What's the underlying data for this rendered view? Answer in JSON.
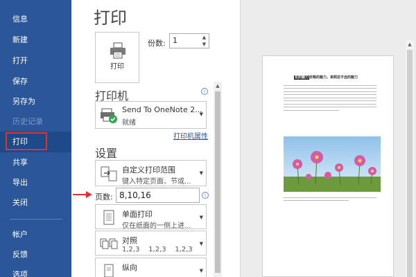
{
  "sidebar": {
    "items": [
      {
        "label": "信息"
      },
      {
        "label": "新建"
      },
      {
        "label": "打开"
      },
      {
        "label": "保存"
      },
      {
        "label": "另存为"
      },
      {
        "label": "历史记录"
      },
      {
        "label": "打印"
      },
      {
        "label": "共享"
      },
      {
        "label": "导出"
      },
      {
        "label": "关闭"
      },
      {
        "label": "帐户"
      },
      {
        "label": "反馈"
      },
      {
        "label": "选项"
      }
    ],
    "active_item": "打印",
    "disabled_item": "历史记录"
  },
  "page_title": "打印",
  "print_button": {
    "label": "打印",
    "icon": "printer-icon"
  },
  "copies": {
    "label": "份数:",
    "value": "1"
  },
  "printer": {
    "section_title": "打印机",
    "name": "Send To OneNote 2...",
    "status": "就绪",
    "properties_link": "打印机属性"
  },
  "settings": {
    "section_title": "设置",
    "range": {
      "line1": "自定义打印范围",
      "line2": "键入特定页面、节或..."
    },
    "pages": {
      "label": "页数:",
      "value": "8,10,16"
    },
    "sides": {
      "line1": "单面打印",
      "line2": "仅在纸面的一侧上进..."
    },
    "collate": {
      "line1": "对照",
      "line2a": "1,2,3",
      "line2b": "1,2,3",
      "line2c": "1,2,3"
    },
    "orientation": {
      "line1": "纵向"
    }
  },
  "preview": {
    "title_highlight": "花的魅力",
    "title_rest": "去略的魅力，来照这不远的魅力"
  },
  "colors": {
    "sidebar_bg": "#2b579a",
    "annotation_red": "#e03030"
  }
}
